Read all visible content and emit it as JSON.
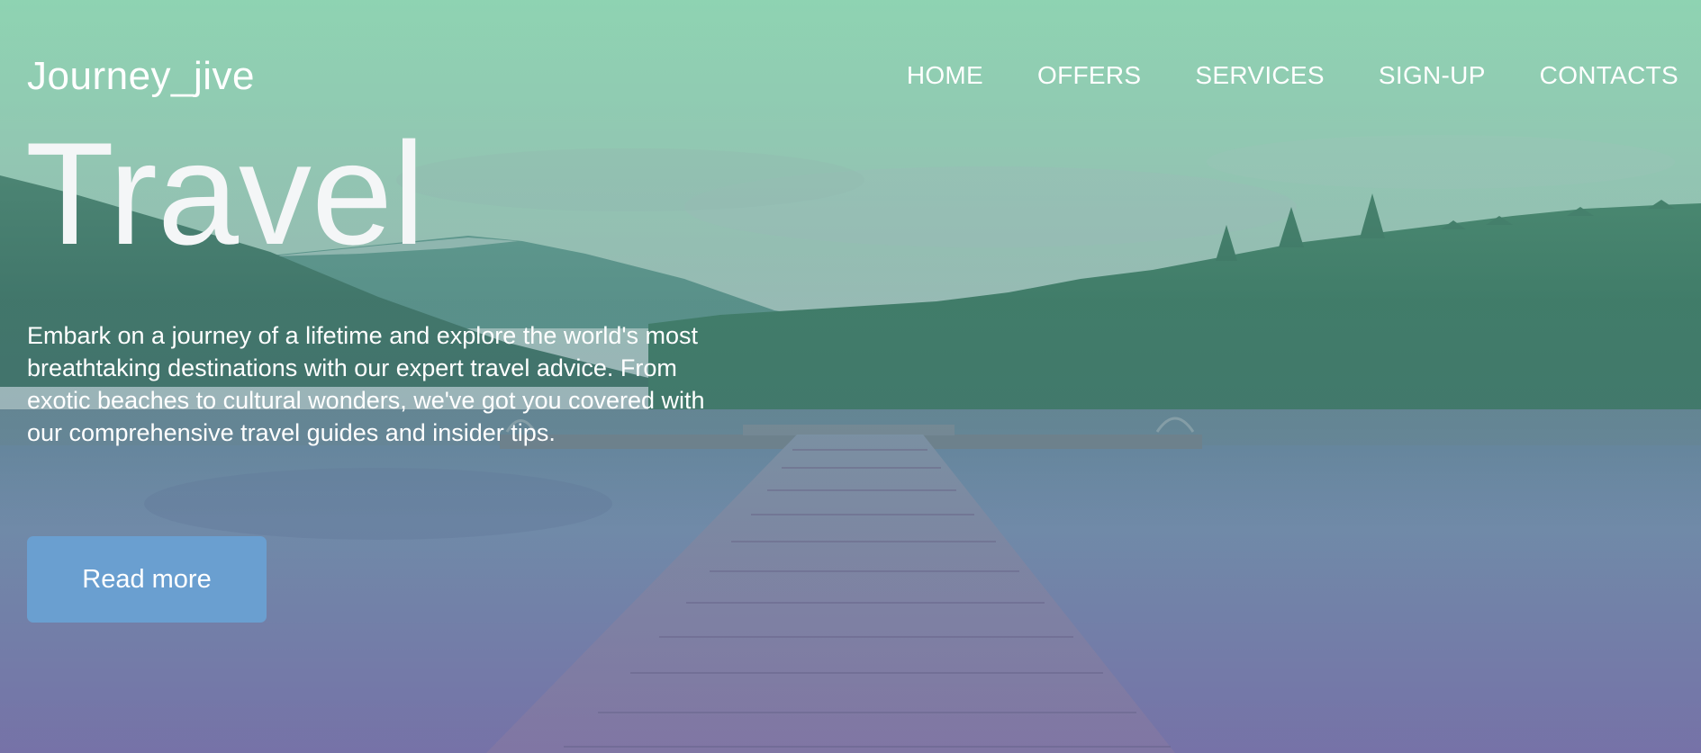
{
  "navbar": {
    "logo": "Journey_jive",
    "links": [
      "HOME",
      "OFFERS",
      "SERVICES",
      "SIGN-UP",
      "CONTACTS"
    ]
  },
  "hero": {
    "headline": "Travel",
    "description": "Embark on a journey of a lifetime and explore the world's most breathtaking destinations with our expert travel advice. From exotic beaches to cultural wonders, we've got you covered with our comprehensive travel guides and insider tips.",
    "cta_label": "Read more",
    "background_icon": "lake-pier-photo"
  },
  "colors": {
    "sky_top": "#8fd1b3",
    "water_bottom": "#7c76a8",
    "button": "#6a9fd0",
    "text": "#ffffff"
  }
}
